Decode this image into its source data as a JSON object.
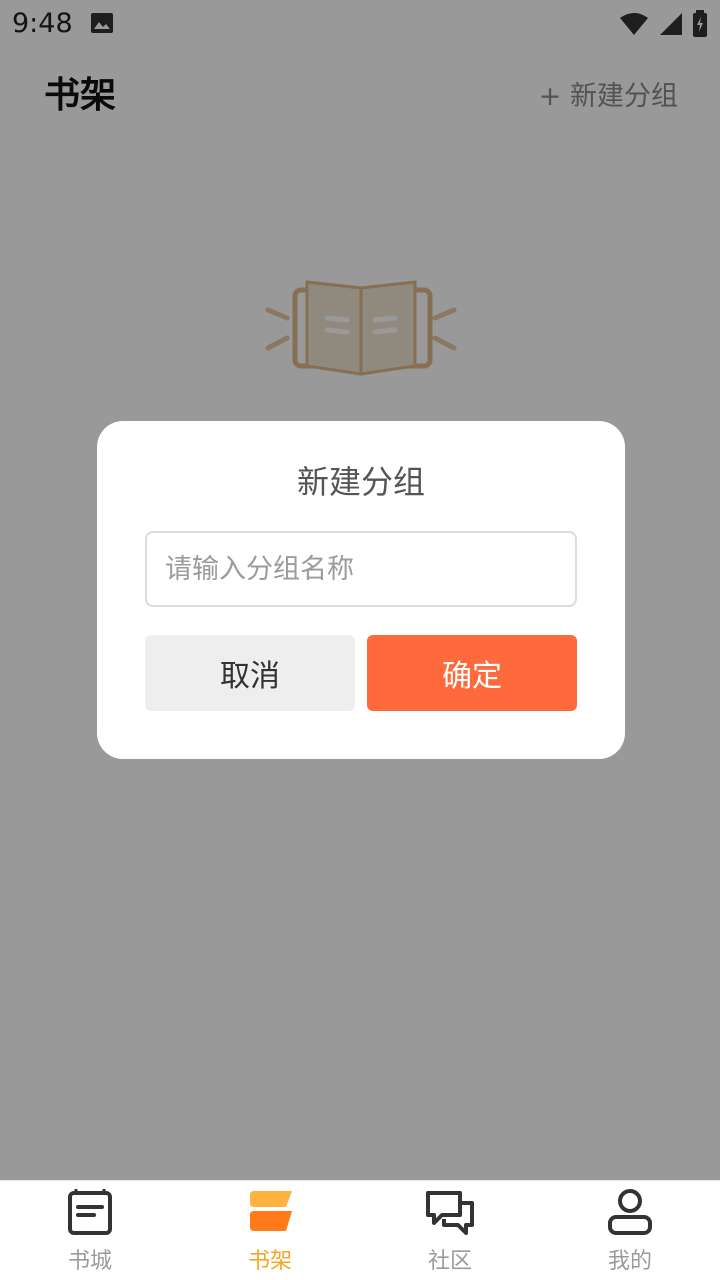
{
  "status_bar": {
    "time": "9:48",
    "icons": [
      "gallery-icon",
      "wifi-icon",
      "signal-icon",
      "battery-icon"
    ]
  },
  "header": {
    "title": "书架",
    "action_label": "+ 新建分组"
  },
  "dialog": {
    "title": "新建分组",
    "input_placeholder": "请输入分组名称",
    "input_value": "",
    "cancel_label": "取消",
    "confirm_label": "确定"
  },
  "bottom_nav": {
    "items": [
      {
        "label": "书城",
        "icon": "bookstore-icon",
        "active": false
      },
      {
        "label": "书架",
        "icon": "bookshelf-icon",
        "active": true
      },
      {
        "label": "社区",
        "icon": "community-icon",
        "active": false
      },
      {
        "label": "我的",
        "icon": "profile-icon",
        "active": false
      }
    ]
  },
  "colors": {
    "accent": "#ff6a3c",
    "nav_active": "#f5a623",
    "overlay": "rgba(0,0,0,0.40)"
  }
}
